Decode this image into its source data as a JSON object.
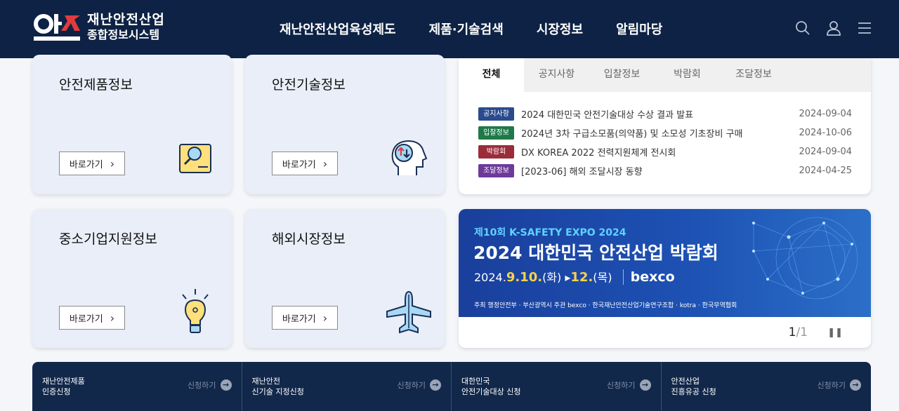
{
  "header": {
    "logo_line1": "재난안전산업",
    "logo_line2": "종합정보시스템",
    "nav": [
      "재난안전산업육성제도",
      "제품·기술검색",
      "시장정보",
      "알림마당"
    ],
    "icons": [
      "search-icon",
      "user-icon",
      "menu-icon"
    ]
  },
  "cards": [
    {
      "title": "안전제품정보",
      "button": "바로가기",
      "icon": "magnifier-document-icon"
    },
    {
      "title": "안전기술정보",
      "button": "바로가기",
      "icon": "head-brain-icon"
    },
    {
      "title": "중소기업지원정보",
      "button": "바로가기",
      "icon": "lightbulb-icon"
    },
    {
      "title": "해외시장정보",
      "button": "바로가기",
      "icon": "airplane-icon"
    }
  ],
  "notice": {
    "tabs": [
      "전체",
      "공지사항",
      "입찰정보",
      "박람회",
      "조달정보"
    ],
    "items": [
      {
        "badge": "공지사항",
        "color": "#2a4b8d",
        "title": "2024 대한민국 안전기술대상 수상 결과 발표",
        "date": "2024-09-04"
      },
      {
        "badge": "입찰정보",
        "color": "#1f7a4a",
        "title": "2024년 3차 구급소모품(의약품) 및 소모성 기초장비 구매",
        "date": "2024-10-06"
      },
      {
        "badge": "박람회",
        "color": "#9b2c3a",
        "title": "DX KOREA 2022 전력지원체계 전시회",
        "date": "2024-09-04"
      },
      {
        "badge": "조달정보",
        "color": "#6d3a9a",
        "title": "[2023-06] 해외 조달시장 동향",
        "date": "2024-04-25"
      }
    ]
  },
  "banner": {
    "subtitle": "제10회 K-SAFETY EXPO 2024",
    "title": "2024 대한민국 안전산업 박람회",
    "date_prefix": "2024.",
    "date_start": "9.10.",
    "day_start": "(화)",
    "arrow": "▸",
    "date_end": "12.",
    "day_end": "(목)",
    "venue": "bexco",
    "hosts": "주최 행정안전부 · 부산광역시   주관 bexco · 한국재난안전산업기술연구조합 · kotra · 한국무역협회",
    "page_current": "1",
    "page_sep": "/",
    "page_total": "1",
    "pause_label": "❚❚"
  },
  "bottom": [
    {
      "label": "재난안전제품\n인증신청",
      "apply": "신청하기"
    },
    {
      "label": "재난안전\n신기술 지정신청",
      "apply": "신청하기"
    },
    {
      "label": "대한민국\n안전기술대상 신청",
      "apply": "신청하기"
    },
    {
      "label": "안전산업\n진흥유공 신청",
      "apply": "신청하기"
    }
  ]
}
